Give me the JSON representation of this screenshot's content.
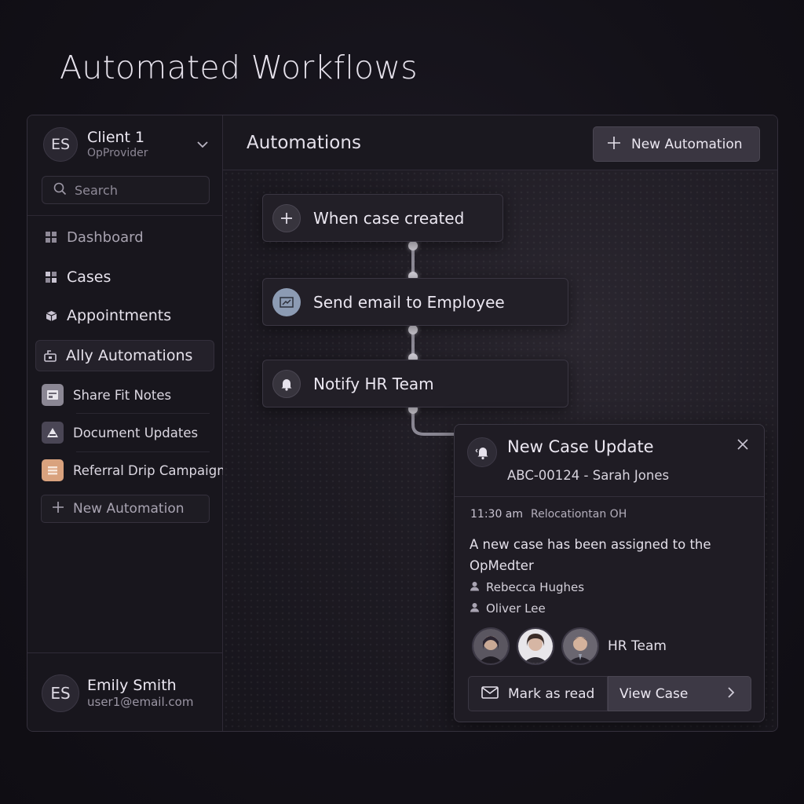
{
  "page": {
    "title": "Automated Workflows"
  },
  "sidebar": {
    "client": {
      "initials": "ES",
      "name": "Client 1",
      "subtitle": "OpProvider"
    },
    "search": {
      "placeholder": "Search"
    },
    "nav": [
      {
        "label": "Dashboard",
        "icon": "grid-icon"
      },
      {
        "label": "Cases",
        "icon": "grid-icon"
      },
      {
        "label": "Appointments",
        "icon": "cube-icon"
      },
      {
        "label": "Ally Automations",
        "icon": "automation-icon"
      }
    ],
    "automations": [
      {
        "label": "Share Fit Notes",
        "icon": "note-icon",
        "color": "#8b8794"
      },
      {
        "label": "Document Updates",
        "icon": "warning-icon",
        "color": "#4a4655"
      },
      {
        "label": "Referral Drip Campaign",
        "icon": "stack-icon",
        "color": "#d9a27e"
      }
    ],
    "new_automation_label": "New Automation",
    "user": {
      "initials": "ES",
      "name": "Emily Smith",
      "email": "user1@email.com"
    }
  },
  "main": {
    "title": "Automations",
    "new_automation_label": "New Automation",
    "workflow": [
      {
        "label": "When case created",
        "icon": "plus-icon"
      },
      {
        "label": "Send email to Employee",
        "icon": "email-icon"
      },
      {
        "label": "Notify HR Team",
        "icon": "bell-icon"
      }
    ]
  },
  "notification": {
    "title": "New Case Update",
    "case_ref": "ABC-00124 - Sarah Jones",
    "time": "11:30 am",
    "location": "Relocationtan OH",
    "message": "A new case has been assigned to the OpMedter",
    "people": [
      "Rebecca Hughes",
      "Oliver Lee"
    ],
    "team_label": "HR Team",
    "mark_read_label": "Mark as read",
    "view_case_label": "View Case"
  },
  "colors": {
    "accent": "#3d3945",
    "background": "#131118",
    "email_icon": "#8c9bb3"
  }
}
